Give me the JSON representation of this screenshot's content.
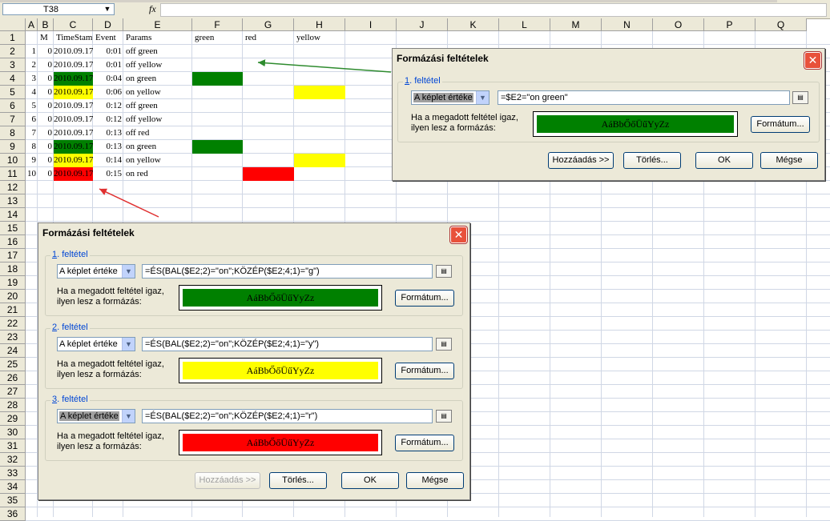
{
  "formula_bar": {
    "name_box": "T38",
    "fx": "fx",
    "formula": ""
  },
  "sheet": {
    "columns": [
      "A",
      "B",
      "C",
      "D",
      "E",
      "F",
      "G",
      "H",
      "I",
      "J",
      "K",
      "L",
      "M",
      "N",
      "O",
      "P",
      "Q"
    ],
    "rows": [
      "1",
      "2",
      "3",
      "4",
      "5",
      "6",
      "7",
      "8",
      "9",
      "10",
      "11",
      "12",
      "13",
      "14",
      "15",
      "16",
      "17",
      "18",
      "19",
      "20",
      "21",
      "22",
      "23",
      "24",
      "25",
      "26",
      "27",
      "28",
      "29",
      "30",
      "31",
      "32",
      "33",
      "34",
      "35",
      "36"
    ],
    "header_row": {
      "B": "M",
      "C": "TimeStamp",
      "D": "Event",
      "E": "Params",
      "F": "green",
      "G": "red",
      "H": "yellow"
    },
    "data": [
      {
        "A": "1",
        "B": "0",
        "C": "2010.09.17",
        "D": "0:01",
        "E": "off green",
        "fill": ""
      },
      {
        "A": "2",
        "B": "0",
        "C": "2010.09.17",
        "D": "0:01",
        "E": "off yellow",
        "fill": ""
      },
      {
        "A": "3",
        "B": "0",
        "C": "2010.09.17",
        "D": "0:04",
        "E": "on green",
        "fill": "green"
      },
      {
        "A": "4",
        "B": "0",
        "C": "2010.09.17",
        "D": "0:06",
        "E": "on yellow",
        "fill": "yellow"
      },
      {
        "A": "5",
        "B": "0",
        "C": "2010.09.17",
        "D": "0:12",
        "E": "off green",
        "fill": ""
      },
      {
        "A": "6",
        "B": "0",
        "C": "2010.09.17",
        "D": "0:12",
        "E": "off yellow",
        "fill": ""
      },
      {
        "A": "7",
        "B": "0",
        "C": "2010.09.17",
        "D": "0:13",
        "E": "off red",
        "fill": ""
      },
      {
        "A": "8",
        "B": "0",
        "C": "2010.09.17",
        "D": "0:13",
        "E": "on green",
        "fill": "green"
      },
      {
        "A": "9",
        "B": "0",
        "C": "2010.09.17",
        "D": "0:14",
        "E": "on yellow",
        "fill": "yellow"
      },
      {
        "A": "10",
        "B": "0",
        "C": "2010.09.17",
        "D": "0:15",
        "E": "on red",
        "fill": "red"
      }
    ],
    "colors": {
      "green": "#008000",
      "yellow": "#ffff00",
      "red": "#ff0000"
    }
  },
  "dialog_small": {
    "title": "Formázási feltételek",
    "condition": {
      "label_num": "1",
      "label_rest": ". feltétel",
      "type": "A képlet értéke",
      "formula": "=$E2=\"on green\"",
      "help_line1": "Ha a megadott feltétel igaz,",
      "help_line2": "ilyen lesz a formázás:",
      "preview_text": "AáBbŐőÜűYyZz",
      "preview_color": "#008000",
      "format_button": "Formátum..."
    },
    "buttons": {
      "add": "Hozzáadás >>",
      "delete": "Törlés...",
      "ok": "OK",
      "cancel": "Mégse"
    }
  },
  "dialog_large": {
    "title": "Formázási feltételek",
    "conditions": [
      {
        "label_num": "1",
        "label_rest": ". feltétel",
        "type": "A képlet értéke",
        "formula": "=ÉS(BAL($E2;2)=\"on\";KÖZÉP($E2;4;1)=\"g\")",
        "help_line1": "Ha a megadott feltétel igaz,",
        "help_line2": "ilyen lesz a formázás:",
        "preview_text": "AáBbŐőÜűYyZz",
        "preview_color": "#008000",
        "format_button": "Formátum..."
      },
      {
        "label_num": "2",
        "label_rest": ". feltétel",
        "type": "A képlet értéke",
        "formula": "=ÉS(BAL($E2;2)=\"on\";KÖZÉP($E2;4;1)=\"y\")",
        "help_line1": "Ha a megadott feltétel igaz,",
        "help_line2": "ilyen lesz a formázás:",
        "preview_text": "AáBbŐőÜűYyZz",
        "preview_color": "#ffff00",
        "format_button": "Formátum..."
      },
      {
        "label_num": "3",
        "label_rest": ". feltétel",
        "type": "A képlet értéke",
        "formula": "=ÉS(BAL($E2;2)=\"on\";KÖZÉP($E2;4;1)=\"r\")",
        "help_line1": "Ha a megadott feltétel igaz,",
        "help_line2": "ilyen lesz a formázás:",
        "preview_text": "AáBbŐőÜűYyZz",
        "preview_color": "#ff0000",
        "format_button": "Formátum..."
      }
    ],
    "buttons": {
      "add": "Hozzáadás >>",
      "delete": "Törlés...",
      "ok": "OK",
      "cancel": "Mégse"
    }
  },
  "arrows": {
    "green_arrow_color": "#2e8b2e",
    "red_arrow_color": "#e03030"
  }
}
